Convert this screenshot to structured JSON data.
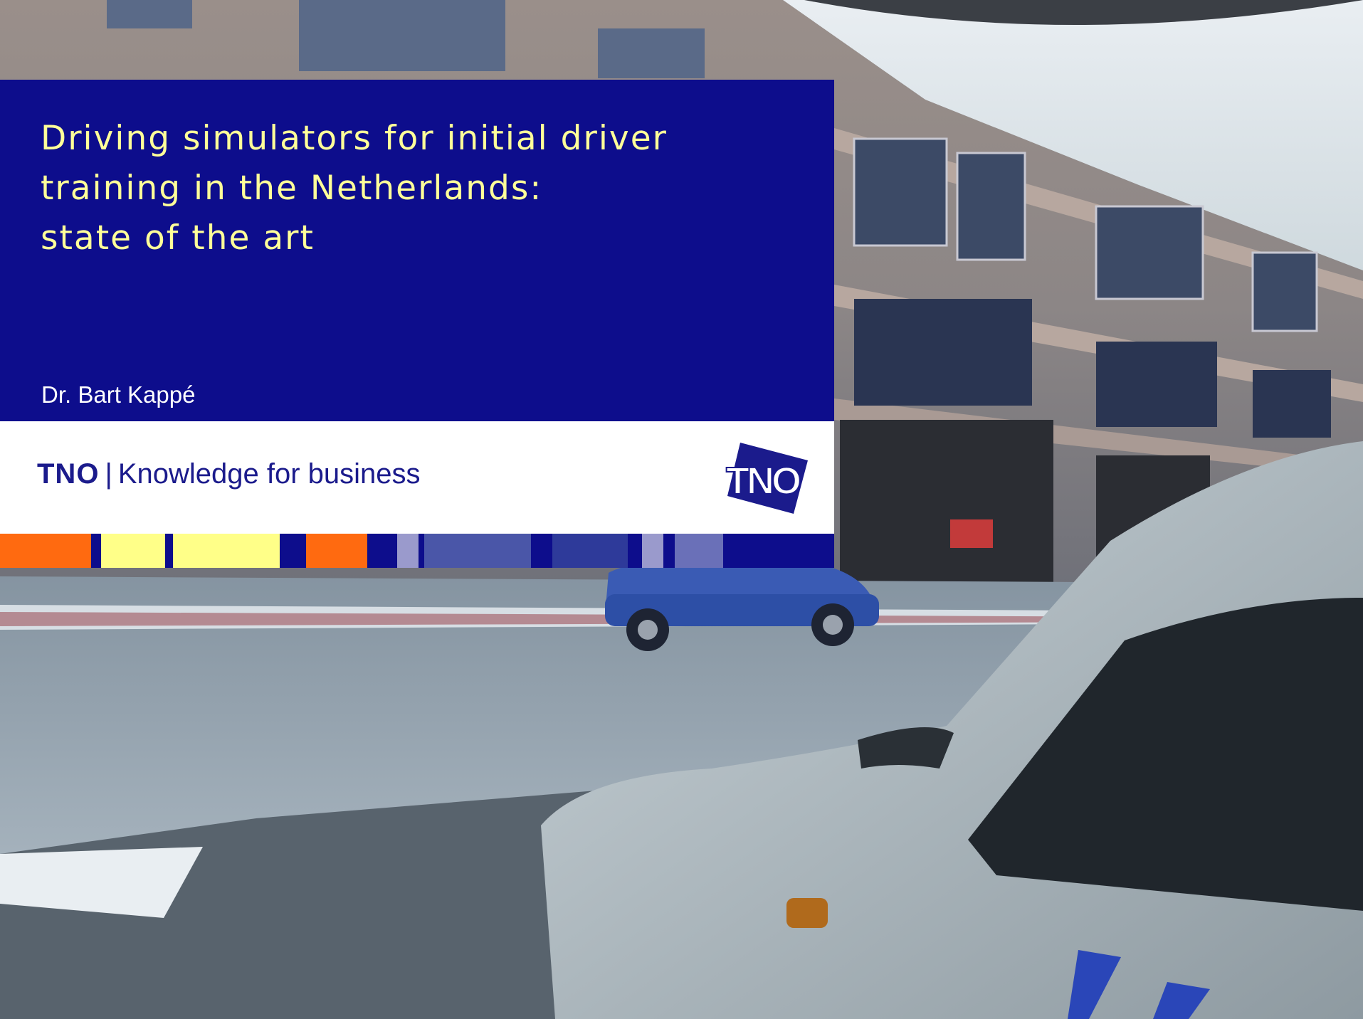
{
  "slide": {
    "title": "Driving simulators for initial driver\ntraining in the Netherlands:\nstate of the art",
    "author": "Dr. Bart Kappé"
  },
  "branding": {
    "brand": "TNO",
    "separator": "|",
    "tagline": "Knowledge for business",
    "logo_text": "TNO"
  },
  "colors": {
    "panel": "#0d0d8c",
    "title": "#ffff99",
    "orange": "#ff6a10",
    "yellow": "#ffff88",
    "light_blue": "#9a9acc",
    "mid_blue": "#4a56a8"
  },
  "photo": {
    "subject": "driving simulator street scene with a blue car and white car hood"
  }
}
